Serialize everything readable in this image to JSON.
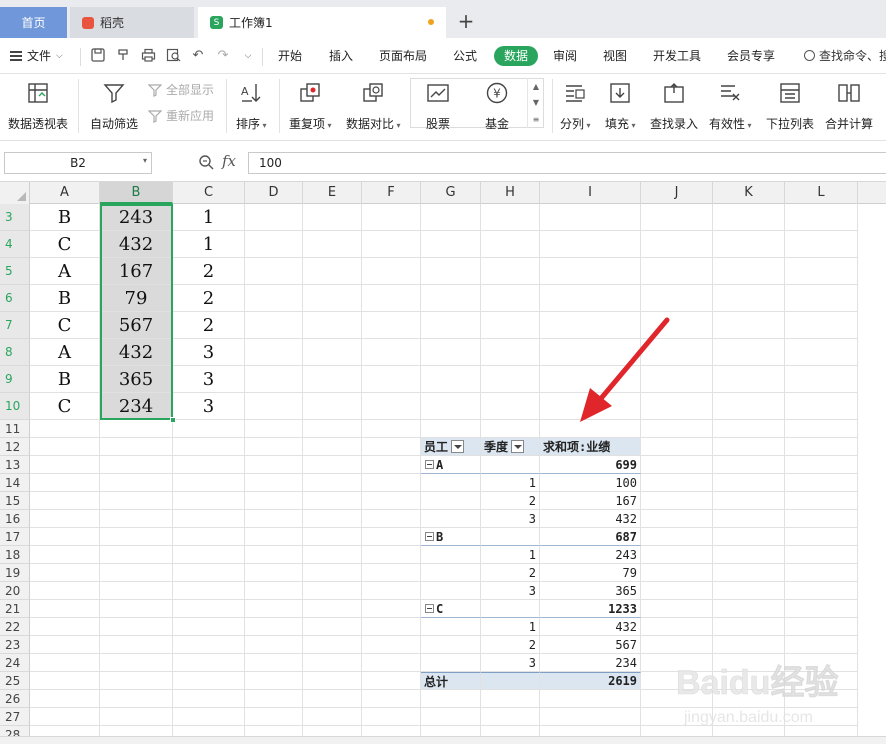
{
  "tabs": {
    "home": "首页",
    "docer": "稻壳",
    "workbook": "工作簿1",
    "workbook_icon": "S"
  },
  "menu": {
    "file": "文件",
    "items": [
      "开始",
      "插入",
      "页面布局",
      "公式",
      "数据",
      "审阅",
      "视图",
      "开发工具",
      "会员专享"
    ],
    "active": "数据",
    "search": "查找命令、搜"
  },
  "ribbon": {
    "pivot": "数据透视表",
    "autofilter": "自动筛选",
    "show_all": "全部显示",
    "reapply": "重新应用",
    "sort": "排序",
    "duplicates": "重复项",
    "compare": "数据对比",
    "stock": "股票",
    "fund": "基金",
    "split": "分列",
    "fill": "填充",
    "lookup": "查找录入",
    "validity": "有效性",
    "dropdown": "下拉列表",
    "consolidate": "合并计算",
    "fund_symbol": "¥"
  },
  "formula": {
    "cell_ref": "B2",
    "fx": "fx",
    "value": "100"
  },
  "columns": [
    "A",
    "B",
    "C",
    "D",
    "E",
    "F",
    "G",
    "H",
    "I",
    "J",
    "K",
    "L"
  ],
  "selected_column": "B",
  "rows": [
    {
      "n": "3",
      "a": "B",
      "b": "243",
      "c": "1"
    },
    {
      "n": "4",
      "a": "C",
      "b": "432",
      "c": "1"
    },
    {
      "n": "5",
      "a": "A",
      "b": "167",
      "c": "2"
    },
    {
      "n": "6",
      "a": "B",
      "b": "79",
      "c": "2"
    },
    {
      "n": "7",
      "a": "C",
      "b": "567",
      "c": "2"
    },
    {
      "n": "8",
      "a": "A",
      "b": "432",
      "c": "3"
    },
    {
      "n": "9",
      "a": "B",
      "b": "365",
      "c": "3"
    },
    {
      "n": "10",
      "a": "C",
      "b": "234",
      "c": "3"
    }
  ],
  "empty_rows": [
    "11",
    "12",
    "13",
    "14",
    "15",
    "16",
    "17",
    "18",
    "19",
    "20",
    "21",
    "22",
    "23",
    "24",
    "25",
    "26",
    "27",
    "28"
  ],
  "pivot": {
    "header_g": "员工",
    "header_h": "季度",
    "header_i": "求和项:业绩",
    "lines": [
      {
        "row": "13",
        "kind": "group",
        "g": "A",
        "i": "699"
      },
      {
        "row": "14",
        "kind": "item",
        "h": "1",
        "i": "100"
      },
      {
        "row": "15",
        "kind": "item",
        "h": "2",
        "i": "167"
      },
      {
        "row": "16",
        "kind": "item",
        "h": "3",
        "i": "432"
      },
      {
        "row": "17",
        "kind": "group",
        "g": "B",
        "i": "687"
      },
      {
        "row": "18",
        "kind": "item",
        "h": "1",
        "i": "243"
      },
      {
        "row": "19",
        "kind": "item",
        "h": "2",
        "i": "79"
      },
      {
        "row": "20",
        "kind": "item",
        "h": "3",
        "i": "365"
      },
      {
        "row": "21",
        "kind": "group",
        "g": "C",
        "i": "1233"
      },
      {
        "row": "22",
        "kind": "item",
        "h": "1",
        "i": "432"
      },
      {
        "row": "23",
        "kind": "item",
        "h": "2",
        "i": "567"
      },
      {
        "row": "24",
        "kind": "item",
        "h": "3",
        "i": "234"
      },
      {
        "row": "25",
        "kind": "total",
        "g": "总计",
        "i": "2619"
      }
    ]
  },
  "colors": {
    "accent": "#2aa55d",
    "arrow": "#e0262b",
    "pivot_header": "#dbe6f1",
    "home_tab": "#6f97d9"
  },
  "watermark": {
    "brand": "Baidu经验",
    "url": "jingyan.baidu.com"
  }
}
